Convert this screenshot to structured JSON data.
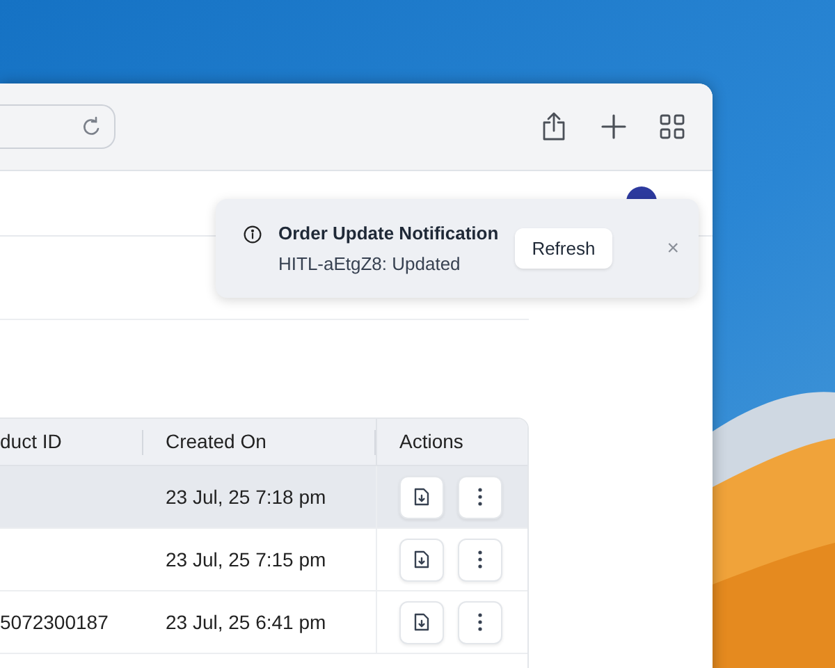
{
  "notification": {
    "title": "Order Update Notification",
    "message": "HITL-aEtgZ8: Updated",
    "action": "Refresh",
    "close": "×"
  },
  "table": {
    "columns": [
      "duct ID",
      "Created On",
      "Actions"
    ],
    "rows": [
      {
        "product_id": "",
        "created_on": "23 Jul, 25 7:18 pm",
        "selected": true
      },
      {
        "product_id": "",
        "created_on": "23 Jul, 25 7:15 pm",
        "selected": false
      },
      {
        "product_id": "5072300187",
        "created_on": "23 Jul, 25 6:41 pm",
        "selected": false
      }
    ]
  }
}
